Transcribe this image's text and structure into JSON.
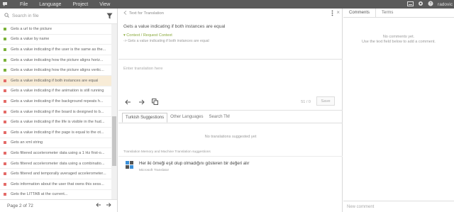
{
  "topbar": {
    "menu": [
      "File",
      "Language",
      "Project",
      "View"
    ],
    "user": "radovic"
  },
  "left": {
    "search_placeholder": "Search in file",
    "items": [
      {
        "text": "Gets a url to the picture",
        "status": "green"
      },
      {
        "text": "Gets a value by name",
        "status": "green"
      },
      {
        "text": "Gets a value indicating if the user is the same as the...",
        "status": "green"
      },
      {
        "text": "Gets a value indicating how the picture aligns horiz...",
        "status": "green"
      },
      {
        "text": "Gets a value indicating how the picture aligns vertic...",
        "status": "green"
      },
      {
        "text": "Gets a value indicating if both instances are equal",
        "status": "red",
        "active": true
      },
      {
        "text": "Gets a value indicating if the animation is still running",
        "status": "red"
      },
      {
        "text": "Gets a value indicating if the background repeats h...",
        "status": "red"
      },
      {
        "text": "Gets a value indicating if the board is designed to b...",
        "status": "red"
      },
      {
        "text": "Gets a value indicating if the life is visible in the hud...",
        "status": "red"
      },
      {
        "text": "Gets a value indicating if the page is equal to the ot...",
        "status": "red"
      },
      {
        "text": "Gets an xml string",
        "status": "red"
      },
      {
        "text": "Gets filtered accelerometer data using a 1 Hz first-o...",
        "status": "red"
      },
      {
        "text": "Gets filtered accelerometer data using a combinatio...",
        "status": "red"
      },
      {
        "text": "Gets filtered and temporally averaged accelerometer...",
        "status": "red"
      },
      {
        "text": "Gets information about the user that owns this sess...",
        "status": "red"
      },
      {
        "text": "Gets the LITTAB at the current...",
        "status": "red"
      }
    ],
    "pager": "Page 2 of 72"
  },
  "center": {
    "header": "Text for Translation",
    "source": "Gets a value indicating if both instances are equal",
    "context_label": "Context / Request Context",
    "context_sub": "-> Gets a value indicating if both instances are equal",
    "translation_placeholder": "Enter translation here",
    "char_count": "51 / 0",
    "save": "Save",
    "tabs": [
      "Turkish Suggestions",
      "Other Languages",
      "Search TM"
    ],
    "no_suggestions": "No translations suggested yet",
    "tm_label": "Translation Memory and Machine Translation suggestions",
    "mt_text": "Her iki örneği eşit olup olmadığını gösteren bir değeri alır",
    "mt_provider": "Microsoft Translator"
  },
  "right": {
    "tabs": [
      "Comments",
      "Terms"
    ],
    "no_comments_1": "No comments yet.",
    "no_comments_2": "Use the text field below to add a comment.",
    "new_comment": "New comment"
  },
  "colors": {
    "topbar": "#5a5a5a",
    "green": "#7bb23a",
    "red": "#e46b68",
    "active_row": "#f8ecd7"
  }
}
